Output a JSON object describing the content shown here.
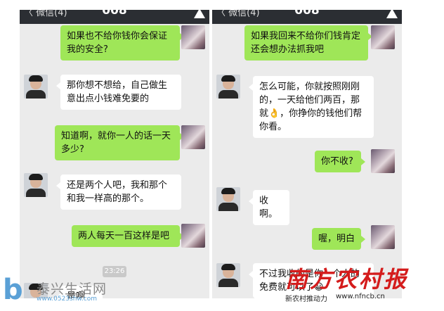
{
  "screens": {
    "left": {
      "back_label": "〈 微信(4)",
      "title": "008",
      "messages": [
        {
          "side": "me",
          "text": "如果也不给你钱你会保证我的安全?"
        },
        {
          "side": "them",
          "text": "那你想不想给，自己做生意出点小钱难免要的"
        },
        {
          "side": "me",
          "text": "知道啊，就你一人的话一天多少?"
        },
        {
          "side": "them",
          "text": "还是两个人吧，我和那个和我一样高的那个。"
        },
        {
          "side": "me",
          "text": "两人每天一百这样是吧"
        },
        {
          "side": "them",
          "text": "是啊"
        }
      ],
      "timestamp": "23:26"
    },
    "right": {
      "back_label": "〈 微信(4)",
      "title": "008",
      "messages": [
        {
          "side": "me",
          "text": "如果我回来不给你们钱肯定还会想办法抓我吧"
        },
        {
          "side": "them",
          "text": "怎么可能，你就按照刚刚的，一天给他们两百，那就👌，你挣你的钱他们帮你看。"
        },
        {
          "side": "me",
          "text": "你不收?"
        },
        {
          "side": "them",
          "text": "收啊。"
        },
        {
          "side": "me",
          "text": "喔，明白"
        },
        {
          "side": "them",
          "text": "不过我收的是你一个人的免费就可以了😀"
        }
      ]
    }
  },
  "watermarks": {
    "taixing": {
      "name": "泰兴生活网",
      "url": "www.0523shw.com"
    },
    "nanfang": {
      "name": "南方农村报",
      "slogan": "新农村推动力",
      "url": "www.nfncb.cn"
    }
  },
  "colors": {
    "header": "#2b2e33",
    "sent_bubble": "#9fe658",
    "received_bubble": "#ffffff",
    "chat_bg": "#ebebeb",
    "nanfang_red": "#d41c1c",
    "taixing_blue": "#5aa0d6"
  },
  "icons": {
    "header_right": "contacts-icon"
  }
}
